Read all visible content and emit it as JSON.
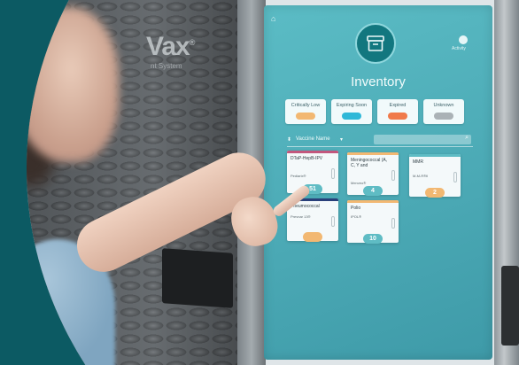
{
  "brand": {
    "name": "Vax",
    "mark": "®",
    "subtitle": "nt System"
  },
  "screen": {
    "title": "Inventory",
    "activity_label": "Activity",
    "icons": {
      "home": "home-icon",
      "inventory": "archive-box-icon",
      "activity": "activity-icon",
      "search": "search-icon"
    },
    "filters": [
      {
        "label": "Critically Low",
        "color": "#f2b872"
      },
      {
        "label": "Expiring Soon",
        "color": "#2fb8d8"
      },
      {
        "label": "Expired",
        "color": "#f07a4a"
      },
      {
        "label": "Unknown",
        "color": "#aab2b6"
      }
    ],
    "sort": {
      "label": "Vaccine Name",
      "chevron": "▾"
    },
    "vaccines": [
      {
        "name": "DTaP-HepB-IPV",
        "sub": "Pediarix®",
        "count": "51",
        "bar": "#c2577d"
      },
      {
        "name": "Meningococcal (A, C, Y and",
        "sub": "Menveo®",
        "count": "4",
        "bar": "#f2b872"
      },
      {
        "name": "MMR",
        "sub": "M-M-R®II",
        "count": "2",
        "bar": "#5fbcc4"
      },
      {
        "name": "Pneumococcal",
        "sub": "Prevnar 13®",
        "count": "",
        "bar": "#29407a"
      },
      {
        "name": "Polio",
        "sub": "IPOL®",
        "count": "10",
        "bar": "#f2b872"
      }
    ]
  }
}
